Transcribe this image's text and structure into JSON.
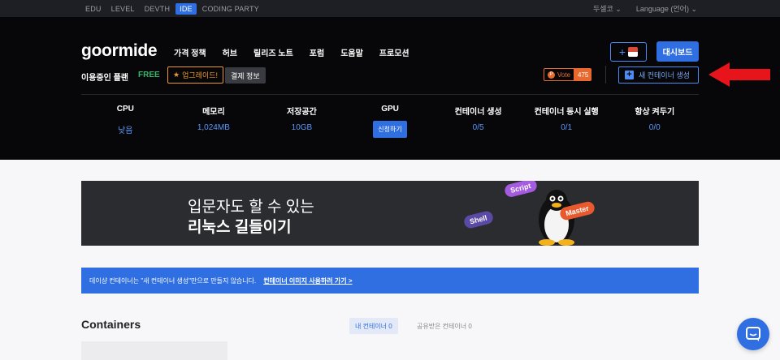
{
  "topnav": {
    "items": [
      {
        "label": "EDU",
        "active": false
      },
      {
        "label": "LEVEL",
        "active": false
      },
      {
        "label": "DEVTH",
        "active": false
      },
      {
        "label": "IDE",
        "active": true
      },
      {
        "label": "CODING PARTY",
        "active": false
      }
    ],
    "user": "두셀코",
    "language": "Language (언어)"
  },
  "header": {
    "logo": "goormide",
    "nav": [
      "가격 정책",
      "허브",
      "릴리즈 노트",
      "포럼",
      "도움말",
      "프로모션"
    ],
    "add_label": "+",
    "dashboard_label": "대시보드"
  },
  "plan": {
    "label": "이용중인 플랜",
    "value": "FREE",
    "upgrade_label": "업그레이드!",
    "payment_label": "결제 정보",
    "vote_label": "Vote",
    "vote_count": "475",
    "create_label": "새 컨테이너 생성"
  },
  "stats": [
    {
      "key": "CPU",
      "value": "낮음"
    },
    {
      "key": "메모리",
      "value": "1,024MB"
    },
    {
      "key": "저장공간",
      "value": "10GB"
    },
    {
      "key": "GPU",
      "button": "신청하기"
    },
    {
      "key": "컨테이너 생성",
      "value": "0/5"
    },
    {
      "key": "컨테이너 동시 실행",
      "value": "0/1"
    },
    {
      "key": "항상 켜두기",
      "value": "0/0"
    }
  ],
  "banner": {
    "line1": "입문자도 할 수 있는",
    "line2": "리눅스 길들이기",
    "tags": {
      "script": "Script",
      "shell": "Shell",
      "master": "Master"
    }
  },
  "info": {
    "text": "데이샹 컨테이너는 \"새 컨테이너 생성\"만으로 만들지 않습니다.",
    "link": "컨테이너 이미지 사용하러 가기 >"
  },
  "containers": {
    "title": "Containers",
    "tab_mine": "내 컨테이너 0",
    "tab_shared": "공유받은 컨테이너 0"
  },
  "colors": {
    "accent": "#2f6fe2",
    "free": "#38b36b",
    "upgrade": "#f0982a",
    "vote": "#e8692e",
    "arrow": "#e8141b"
  },
  "icons": [
    "star-icon",
    "plus-icon",
    "arrow-icon",
    "penguin-icon",
    "chat-icon"
  ]
}
